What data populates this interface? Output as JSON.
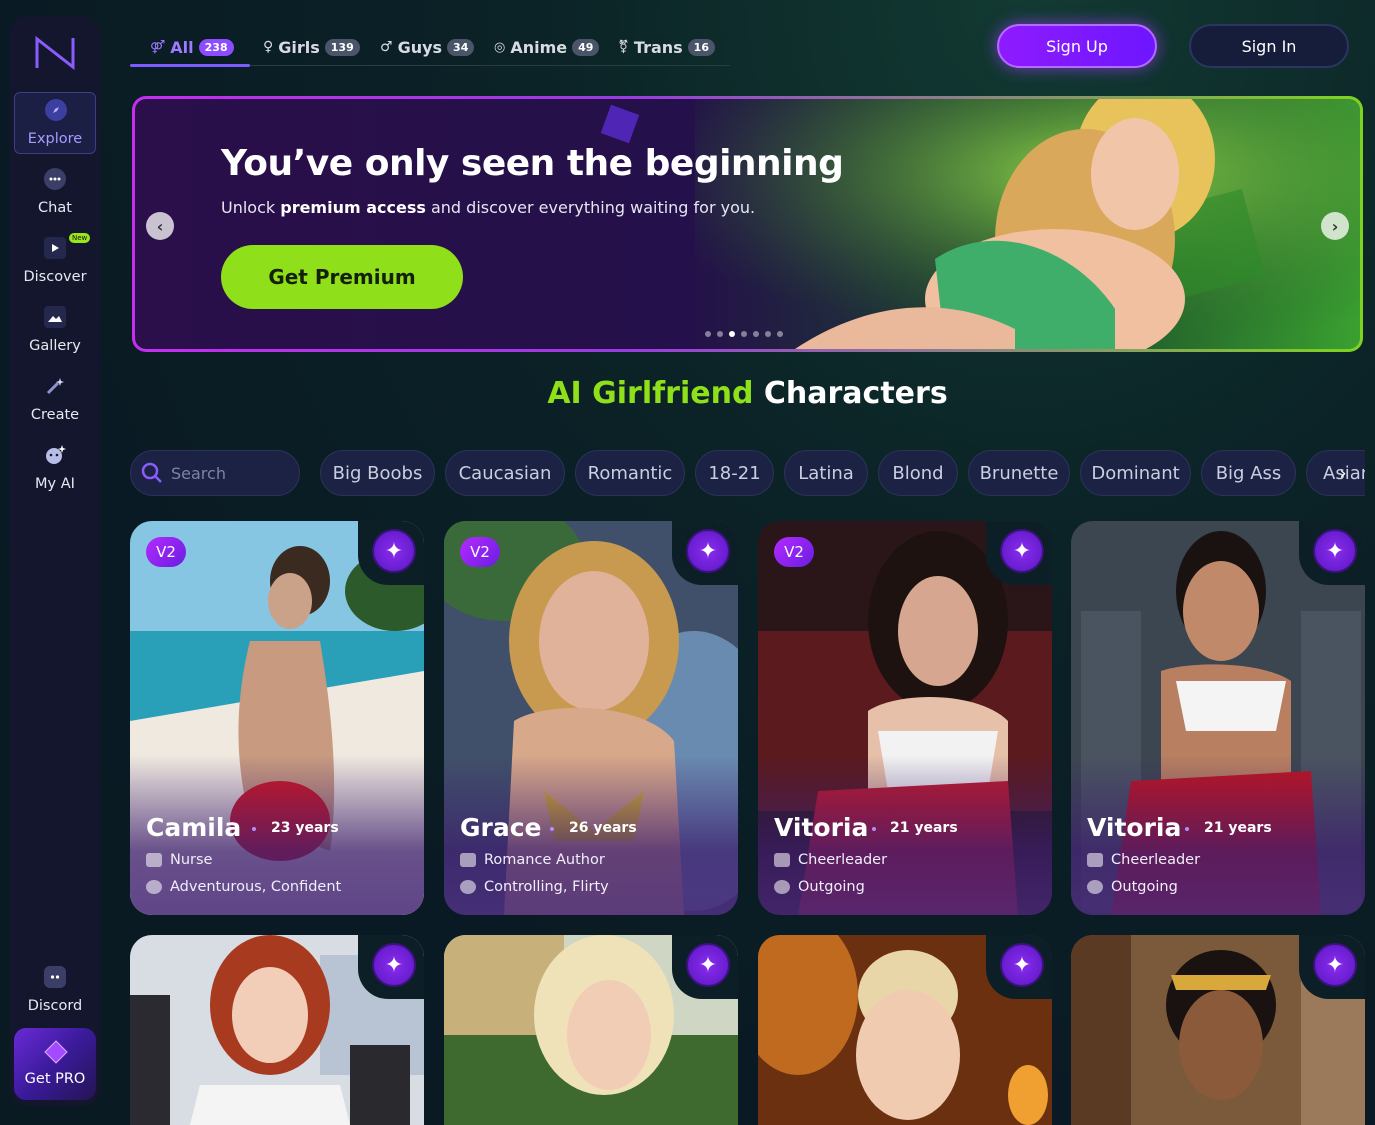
{
  "sidebar": {
    "items": [
      {
        "label": "Explore",
        "icon": "compass-icon"
      },
      {
        "label": "Chat",
        "icon": "chat-bubble-icon"
      },
      {
        "label": "Discover",
        "icon": "play-icon",
        "badge": "New"
      },
      {
        "label": "Gallery",
        "icon": "image-icon"
      },
      {
        "label": "Create",
        "icon": "magic-wand-icon"
      },
      {
        "label": "My AI",
        "icon": "ai-face-icon"
      }
    ],
    "discord_label": "Discord",
    "getpro_label": "Get PRO"
  },
  "tabs": [
    {
      "label": "All",
      "count": "238",
      "icon": "all-gender-icon"
    },
    {
      "label": "Girls",
      "count": "139",
      "icon": "female-icon"
    },
    {
      "label": "Guys",
      "count": "34",
      "icon": "male-icon"
    },
    {
      "label": "Anime",
      "count": "49",
      "icon": "anime-icon"
    },
    {
      "label": "Trans",
      "count": "16",
      "icon": "trans-icon"
    }
  ],
  "header": {
    "signup_label": "Sign Up",
    "signin_label": "Sign In"
  },
  "banner": {
    "title": "You’ve only seen the beginning",
    "subtitle_pre": "Unlock ",
    "subtitle_bold": "premium access",
    "subtitle_post": " and discover everything waiting for you.",
    "cta_label": "Get Premium",
    "prev_icon": "‹",
    "next_icon": "›"
  },
  "section": {
    "title_accent": "AI Girlfriend",
    "title_rest": "Characters"
  },
  "search": {
    "placeholder": "Search"
  },
  "filters": [
    "Big Boobs",
    "Caucasian",
    "Romantic",
    "18-21",
    "Latina",
    "Blond",
    "Brunette",
    "Dominant",
    "Big Ass",
    "Asian"
  ],
  "cards": [
    {
      "badge": "V2",
      "name": "Camila",
      "age": "23 years",
      "job": "Nurse",
      "traits": "Adventurous, Confident"
    },
    {
      "badge": "V2",
      "name": "Grace",
      "age": "26 years",
      "job": "Romance Author",
      "traits": "Controlling, Flirty"
    },
    {
      "badge": "V2",
      "name": "Vitoria",
      "age": "21 years",
      "job": "Cheerleader",
      "traits": "Outgoing"
    },
    {
      "badge": "",
      "name": "Vitoria",
      "age": "21 years",
      "job": "Cheerleader",
      "traits": "Outgoing"
    }
  ],
  "colors": {
    "accent_green": "#8fe01a",
    "accent_purple": "#8b4dff"
  }
}
